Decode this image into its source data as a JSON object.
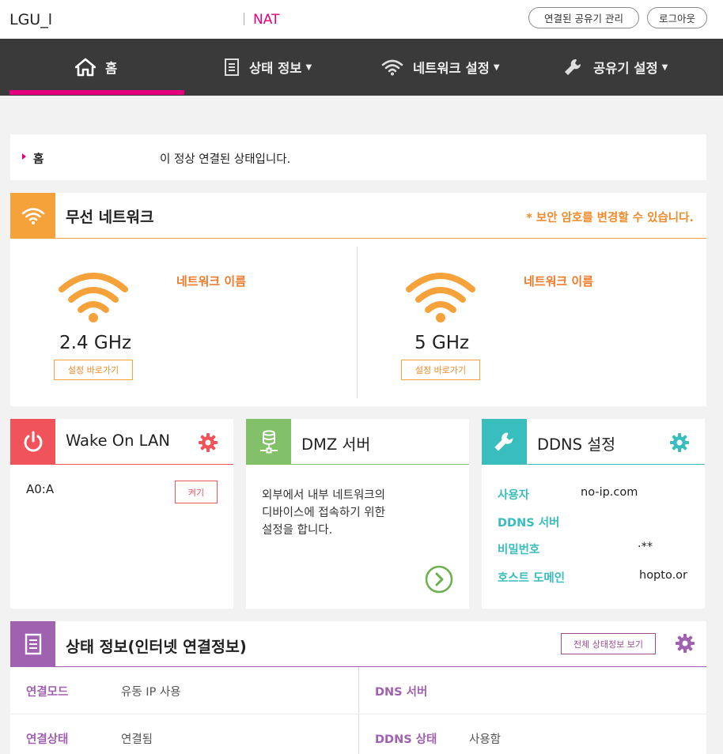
{
  "header": {
    "brand": "LGU_l",
    "mode": "NAT",
    "manage_button": "연결된 공유기 관리",
    "logout_button": "로그아웃"
  },
  "nav": {
    "items": [
      {
        "label": "홈",
        "icon": "home-icon"
      },
      {
        "label": "상태 정보",
        "icon": "document-icon"
      },
      {
        "label": "네트워크 설정",
        "icon": "wifi-icon"
      },
      {
        "label": "공유기 설정",
        "icon": "wrench-icon"
      }
    ],
    "active": "홈",
    "accent": "#e6007e"
  },
  "breadcrumb": {
    "current": "홈",
    "message": "이 정상 연결된 상태입니다."
  },
  "wireless": {
    "title": "무선 네트워크",
    "note": "* 보안 암호를 변경할 수 있습니다.",
    "accent": "#f5a23a",
    "bands": [
      {
        "label": "2.4 GHz",
        "name_label": "네트워크 이름",
        "button": "설정 바로가기"
      },
      {
        "label": "5 GHz",
        "name_label": "네트워크 이름",
        "button": "설정 바로가기"
      }
    ]
  },
  "wol": {
    "title": "Wake On LAN",
    "accent": "#f0545a",
    "mac": "A0:A",
    "button": "켜기"
  },
  "dmz": {
    "title": "DMZ 서버",
    "accent": "#82c06a",
    "line1": "외부에서 내부 네트워크의",
    "line2": "디바이스에 접속하기 위한",
    "line3": "설정을 합니다."
  },
  "ddns": {
    "title": "DDNS 설정",
    "accent": "#3abdbd",
    "rows": [
      {
        "label": "사용자",
        "value": "no-ip.com"
      },
      {
        "label": "DDNS 서버",
        "value": ""
      },
      {
        "label": "비밀번호",
        "value": "·**"
      },
      {
        "label": "호스트 도메인",
        "value": "hopto.or"
      }
    ]
  },
  "status": {
    "title": "상태 정보(인터넷 연결정보)",
    "accent": "#a061b0",
    "button": "전체 상태정보 보기",
    "left": [
      {
        "label": "연결모드",
        "value": "유동 IP 사용"
      },
      {
        "label": "연결상태",
        "value": "연결됨"
      }
    ],
    "right": [
      {
        "label": "DNS 서버",
        "value": ""
      },
      {
        "label": "DDNS 상태",
        "value": "사용함"
      }
    ]
  }
}
